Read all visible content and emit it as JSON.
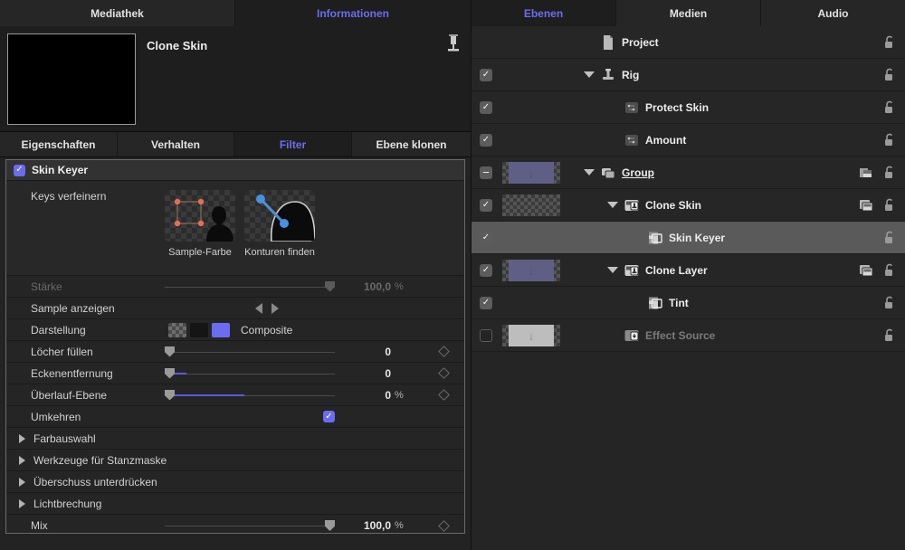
{
  "left_panel": {
    "top_tabs": [
      {
        "label": "Mediathek",
        "active": false
      },
      {
        "label": "Informationen",
        "active": true
      }
    ],
    "info": {
      "title": "Clone Skin",
      "pin_icon": "pin-icon"
    },
    "sub_tabs": [
      {
        "label": "Eigenschaften",
        "active": false
      },
      {
        "label": "Verhalten",
        "active": false
      },
      {
        "label": "Filter",
        "active": true
      },
      {
        "label": "Ebene klonen",
        "active": false
      }
    ],
    "filter": {
      "name": "Skin Keyer",
      "enabled": true,
      "refine": {
        "label": "Keys verfeinern",
        "buttons": [
          {
            "caption": "Sample-Farbe",
            "icon": "sample-color-icon"
          },
          {
            "caption": "Konturen finden",
            "icon": "find-edges-icon"
          }
        ]
      },
      "params": [
        {
          "name": "Stärke",
          "value": "100,0",
          "unit": "%",
          "disabled": true,
          "slider": true,
          "knob": 100,
          "fill": 0,
          "keyframe": false
        },
        {
          "name": "Sample anzeigen",
          "value": "",
          "unit": "",
          "disabled": false,
          "slider": false,
          "arrows": true
        },
        {
          "name": "Darstellung",
          "value": "Composite",
          "unit": "",
          "disabled": false,
          "slider": false,
          "viewmodes": true,
          "selected_view": 2
        },
        {
          "name": "Löcher füllen",
          "value": "0",
          "unit": "",
          "disabled": false,
          "slider": true,
          "knob": 0,
          "fill": 0,
          "keyframe": true
        },
        {
          "name": "Eckenentfernung",
          "value": "0",
          "unit": "",
          "disabled": false,
          "slider": true,
          "knob": 0,
          "fill": 13,
          "keyframe": true
        },
        {
          "name": "Überlauf-Ebene",
          "value": "0",
          "unit": "%",
          "disabled": false,
          "slider": true,
          "knob": 0,
          "fill": 47,
          "keyframe": true
        },
        {
          "name": "Umkehren",
          "value": "",
          "unit": "",
          "disabled": false,
          "slider": false,
          "checkbox": true,
          "checked": true
        }
      ],
      "disclosure_groups": [
        {
          "label": "Farbauswahl",
          "expanded": false
        },
        {
          "label": "Werkzeuge für Stanzmaske",
          "expanded": false
        },
        {
          "label": "Überschuss unterdrücken",
          "expanded": false
        },
        {
          "label": "Lichtbrechung",
          "expanded": false
        }
      ],
      "mix": {
        "name": "Mix",
        "value": "100,0",
        "unit": "%",
        "knob": 100,
        "keyframe": true
      }
    }
  },
  "right_panel": {
    "tabs": [
      {
        "label": "Ebenen",
        "active": true
      },
      {
        "label": "Medien",
        "active": false
      },
      {
        "label": "Audio",
        "active": false
      }
    ],
    "layers": [
      {
        "name": "Project",
        "icon": "document-icon",
        "indent": 0,
        "checkbox": "none",
        "thumb": "none",
        "triangle": false,
        "selected": false,
        "dimmed": false,
        "underline": false,
        "badge": "none",
        "lock": "unlocked-icon"
      },
      {
        "name": "Rig",
        "icon": "rig-icon",
        "indent": 0,
        "checkbox": "checked",
        "thumb": "none",
        "triangle": true,
        "selected": false,
        "dimmed": false,
        "underline": false,
        "badge": "none",
        "lock": "unlocked-icon"
      },
      {
        "name": "Protect Skin",
        "icon": "parameter-icon",
        "indent": 1,
        "checkbox": "checked",
        "thumb": "none",
        "triangle": false,
        "selected": false,
        "dimmed": false,
        "underline": false,
        "badge": "none",
        "lock": "unlocked-icon"
      },
      {
        "name": "Amount",
        "icon": "parameter-icon",
        "indent": 1,
        "checkbox": "checked",
        "thumb": "none",
        "triangle": false,
        "selected": false,
        "dimmed": false,
        "underline": false,
        "badge": "none",
        "lock": "unlocked-icon"
      },
      {
        "name": "Group",
        "icon": "group-icon",
        "indent": 0,
        "checkbox": "minus",
        "thumb": "purple",
        "triangle": true,
        "selected": false,
        "dimmed": false,
        "underline": true,
        "badge": "mask-icon",
        "lock": "unlocked-icon"
      },
      {
        "name": "Clone Skin",
        "icon": "clone-layer-icon",
        "indent": 1,
        "checkbox": "checked",
        "thumb": "empty",
        "triangle": true,
        "selected": false,
        "dimmed": false,
        "underline": false,
        "badge": "clone-badge-icon",
        "lock": "unlocked-icon"
      },
      {
        "name": "Skin Keyer",
        "icon": "filter-icon",
        "indent": 2,
        "checkbox": "checked",
        "thumb": "none",
        "triangle": false,
        "selected": true,
        "dimmed": false,
        "underline": false,
        "badge": "none",
        "lock": "unlocked-icon"
      },
      {
        "name": "Clone Layer",
        "icon": "clone-layer-icon",
        "indent": 1,
        "checkbox": "checked",
        "thumb": "purple",
        "triangle": true,
        "selected": false,
        "dimmed": false,
        "underline": false,
        "badge": "clone-badge-icon",
        "lock": "unlocked-icon"
      },
      {
        "name": "Tint",
        "icon": "filter-icon",
        "indent": 2,
        "checkbox": "checked",
        "thumb": "none",
        "triangle": false,
        "selected": false,
        "dimmed": false,
        "underline": false,
        "badge": "none",
        "lock": "unlocked-icon"
      },
      {
        "name": "Effect Source",
        "icon": "effect-source-icon",
        "indent": 1,
        "checkbox": "unchecked",
        "thumb": "grey",
        "triangle": false,
        "selected": false,
        "dimmed": true,
        "underline": false,
        "badge": "none",
        "lock": "unlocked-icon"
      }
    ]
  },
  "colors": {
    "accent_blue": "#6c6cf0",
    "panel_bg": "#252525",
    "selected_row": "#5a5a5a",
    "thumb_purple": "#5f5f86"
  }
}
